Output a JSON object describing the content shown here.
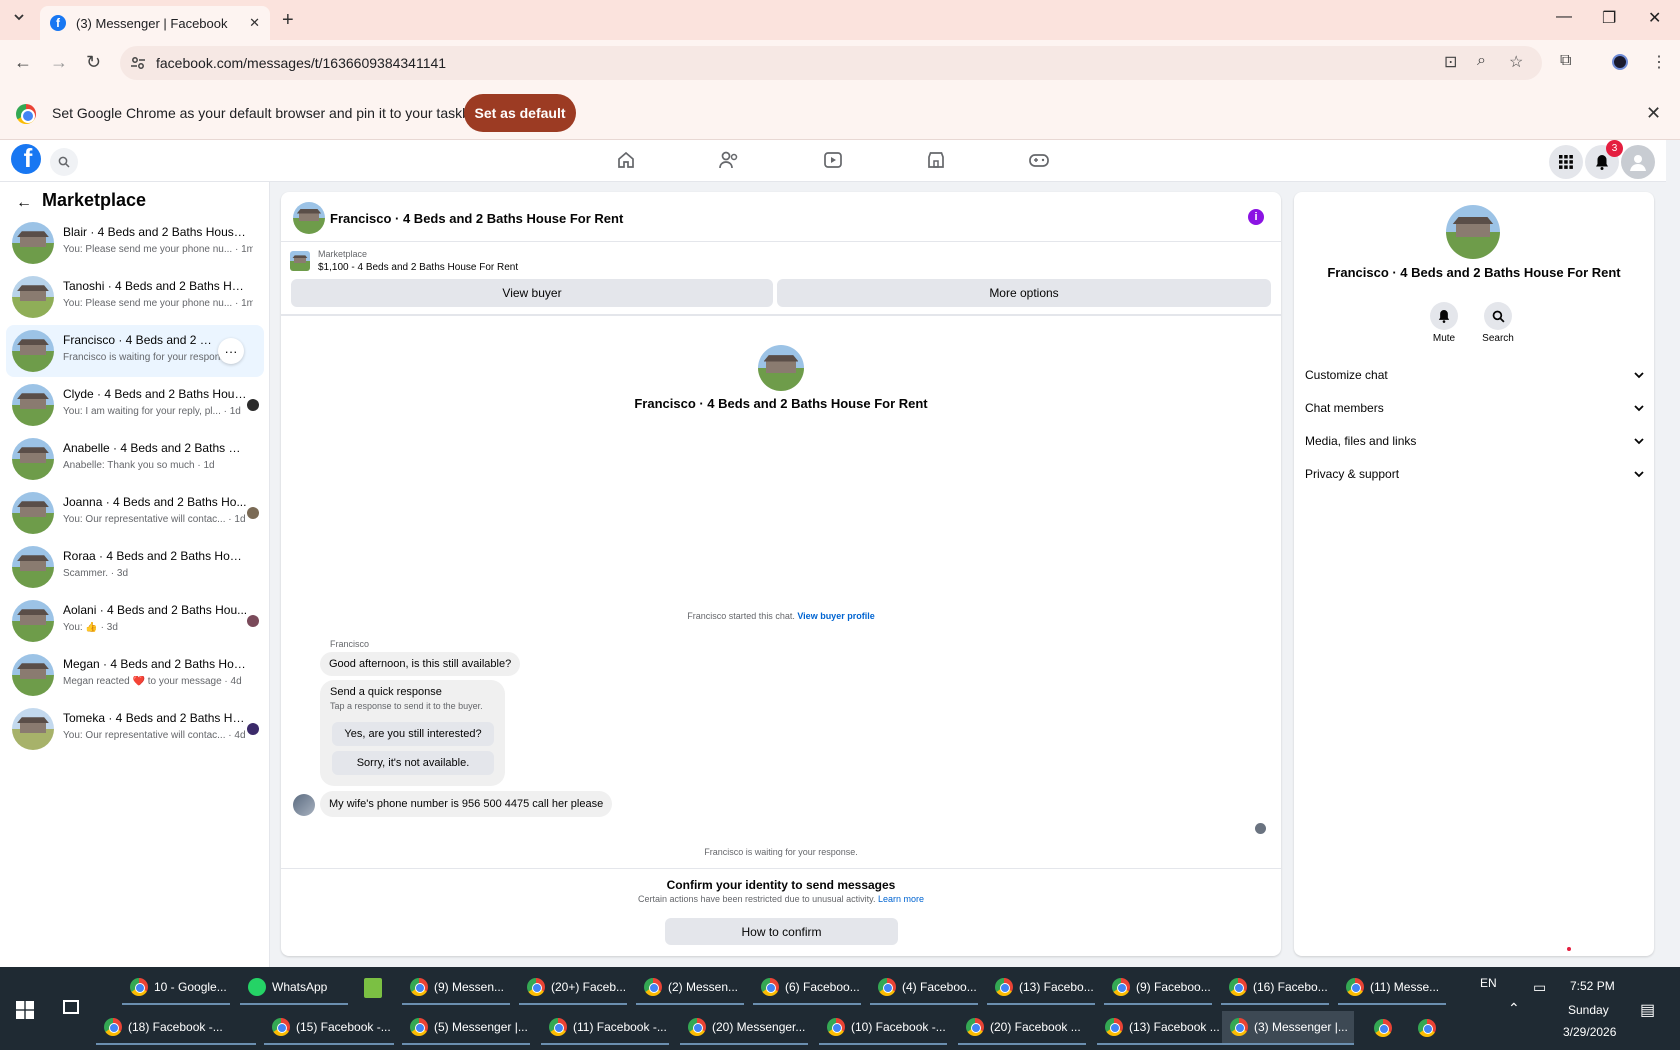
{
  "browser": {
    "tab_title": "(3) Messenger | Facebook",
    "url": "facebook.com/messages/t/1636609384341141",
    "infobar_message": "Set Google Chrome as your default browser and pin it to your taskbar",
    "infobar_button": "Set as default"
  },
  "fb_nav": {
    "notification_count": "3",
    "logo": "f"
  },
  "sidebar": {
    "title": "Marketplace",
    "conversations": [
      {
        "name": "Blair · 4 Beds and 2 Baths House F...",
        "preview": "You: Please send me your phone nu... · 1m"
      },
      {
        "name": "Tanoshi · 4 Beds and 2 Baths Hous...",
        "preview": "You: Please send me your phone nu... · 1m"
      },
      {
        "name": "Francisco · 4 Beds and 2 Baths ...",
        "preview": "Francisco is waiting for your respons...",
        "more": "···"
      },
      {
        "name": "Clyde · 4 Beds and 2 Baths Hous...",
        "preview": "You: I am waiting for your reply, pl... · 1d"
      },
      {
        "name": "Anabelle · 4 Beds and 2 Baths Hou...",
        "preview": "Anabelle: Thank you so much · 1d"
      },
      {
        "name": "Joanna · 4 Beds and 2 Baths Ho...",
        "preview": "You: Our representative will contac... · 1d"
      },
      {
        "name": "Roraa · 4 Beds and 2 Baths House ...",
        "preview": "Scammer. · 3d"
      },
      {
        "name": "Aolani · 4 Beds and 2 Baths Hou...",
        "preview": "You: 👍 · 3d"
      },
      {
        "name": "Megan · 4 Beds and 2 Baths House...",
        "preview": "Megan reacted ❤️ to your message · 4d"
      },
      {
        "name": "Tomeka · 4 Beds and 2 Baths Ho...",
        "preview": "You: Our representative will contac... · 4d"
      }
    ]
  },
  "chat": {
    "title": "Francisco · 4 Beds and 2 Baths House For Rent",
    "listing_source": "Marketplace",
    "listing_price": "$1,100 - 4 Beds and 2 Baths House For Rent",
    "view_buyer": "View buyer",
    "more_options": "More options",
    "hero_title": "Francisco · 4 Beds and 2 Baths House For Rent",
    "started_text": "Francisco started this chat.",
    "view_profile": "View buyer profile",
    "sender": "Francisco",
    "message1": "Good afternoon, is this still available?",
    "quick_title": "Send a quick response",
    "quick_sub": "Tap a response to send it to the buyer.",
    "quick_1": "Yes, are you still interested?",
    "quick_2": "Sorry, it's not available.",
    "message2": "My wife's phone number is 956 500 4475 call her please",
    "waiting": "Francisco is waiting for your response.",
    "confirm_title": "Confirm your identity to send messages",
    "confirm_sub": "Certain actions have been restricted due to unusual activity.",
    "learn_more": "Learn more",
    "how_to_confirm": "How to confirm"
  },
  "right_panel": {
    "title": "Francisco · 4 Beds and 2 Baths House For Rent",
    "mute": "Mute",
    "search": "Search",
    "rows": [
      "Customize chat",
      "Chat members",
      "Media, files and links",
      "Privacy & support"
    ]
  },
  "taskbar": {
    "row1": [
      "10 - Google...",
      "WhatsApp",
      "",
      "(9) Messen...",
      "(20+) Faceb...",
      "(2) Messen...",
      "(6) Faceboo...",
      "(4) Faceboo...",
      "(13) Facebo...",
      "(9) Faceboo...",
      "(16) Facebo...",
      "(11) Messe..."
    ],
    "row2": [
      "(18) Facebook -...",
      "(15) Facebook -...",
      "(5) Messenger |...",
      "(11) Facebook -...",
      "(20) Messenger...",
      "(10) Facebook -...",
      "(20) Facebook ...",
      "(13) Facebook ...",
      "(3) Messenger |...",
      "",
      ""
    ],
    "lang": "EN",
    "time": "7:52 PM",
    "day": "Sunday",
    "date": "3/29/2026"
  }
}
